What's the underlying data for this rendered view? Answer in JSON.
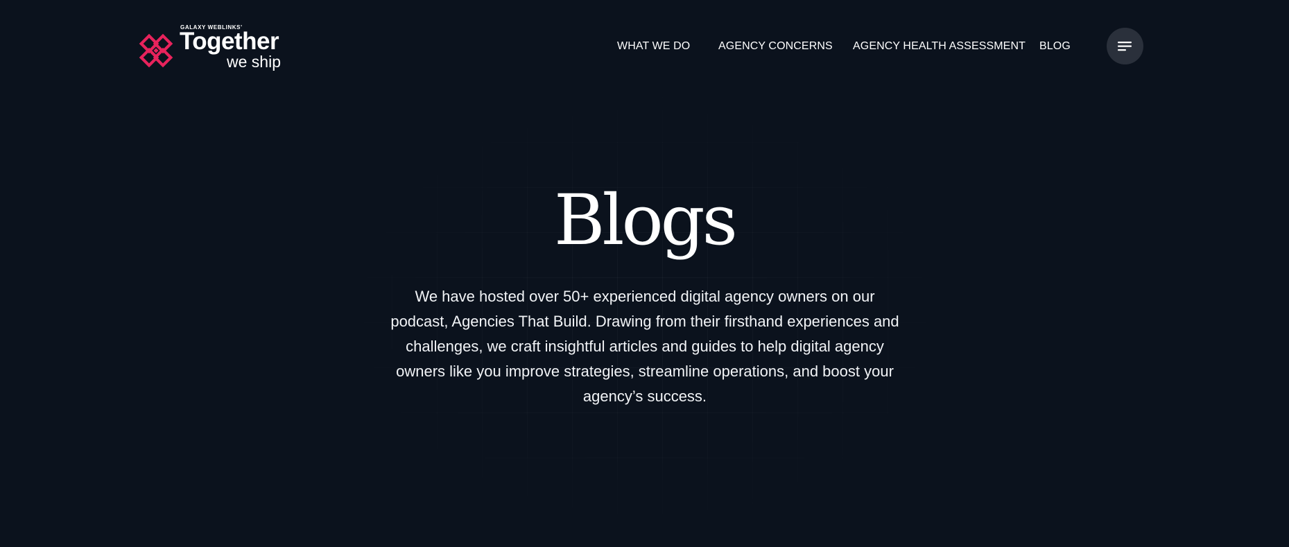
{
  "header": {
    "logo": {
      "pre_text": "GALAXY WEBLINKS'",
      "main_text": "Together",
      "sub_text": "we ship"
    },
    "nav": [
      {
        "label": "WHAT WE DO"
      },
      {
        "label": "AGENCY CONCERNS"
      },
      {
        "label": "AGENCY HEALTH ASSESSMENT"
      },
      {
        "label": "BLOG"
      }
    ],
    "menu_icon": "menu-lines-icon"
  },
  "hero": {
    "title": "Blogs",
    "description": "We have hosted over 50+ experienced digital agency owners on our podcast, Agencies That Build. Drawing from their firsthand experiences and challenges, we craft insightful articles and guides to help digital agency owners like you improve strategies, streamline operations, and boost your agency’s success."
  },
  "colors": {
    "background": "#0b121d",
    "brand_accent": "#e8235c",
    "text": "#ffffff",
    "menu_button_bg": "#2a303b"
  }
}
